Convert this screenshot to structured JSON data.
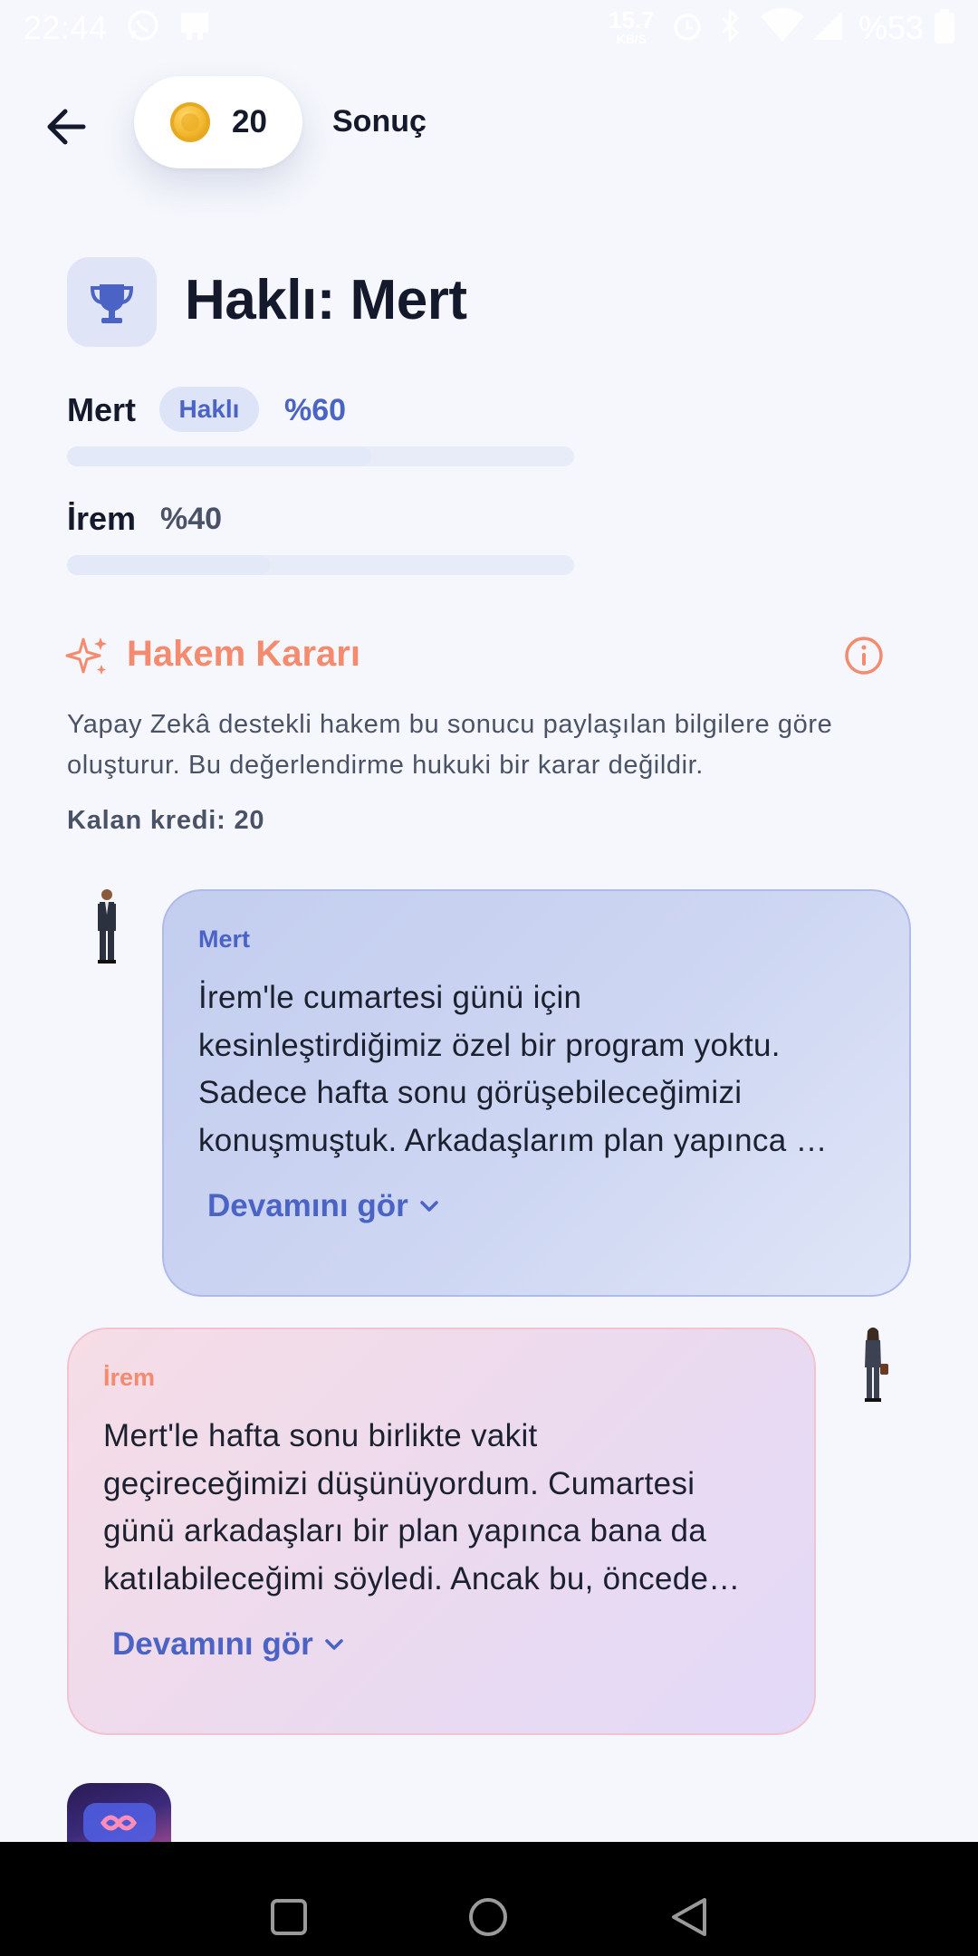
{
  "status_bar": {
    "time": "22:44",
    "net_speed_value": "15.7",
    "net_speed_unit": "KB/S",
    "battery": "%53",
    "icons": [
      "whatsapp-icon",
      "notification-icon",
      "alarm-icon",
      "bluetooth-icon",
      "wifi-icon",
      "signal-icon",
      "battery-icon"
    ]
  },
  "header": {
    "back_icon": "arrow-left-icon",
    "coin_count": "20",
    "title": "Sonuç"
  },
  "verdict": {
    "icon": "trophy-icon",
    "title": "Haklı: Mert"
  },
  "scores": [
    {
      "name": "Mert",
      "badge": "Haklı",
      "percent_label": "%60",
      "value": 0.6,
      "color": "#4a63c4"
    },
    {
      "name": "İrem",
      "badge": "",
      "percent_label": "%40",
      "value": 0.4,
      "color": "#4a5266"
    }
  ],
  "judge": {
    "icon": "sparkles-icon",
    "title": "Hakem Kararı",
    "info_icon": "info-icon",
    "description": "Yapay Zekâ destekli hakem bu sonucu paylaşılan bilgilere göre oluşturur. Bu değerlendirme hukuki bir karar değildir.",
    "credits": "Kalan kredi: 20"
  },
  "statements": [
    {
      "author": "Mert",
      "author_color": "#4a63c4",
      "lines": [
        "İrem'le cumartesi günü için",
        "kesinleştirdiğimiz özel bir program yoktu.",
        "Sadece hafta sonu görüşebileceğimizi",
        "konuşmuştuk. Arkadaşlarım plan yapınca …"
      ],
      "more_label": "Devamını gör"
    },
    {
      "author": "İrem",
      "author_color": "#f48a6e",
      "lines": [
        "Mert'le hafta sonu birlikte vakit",
        "geçireceğimizi düşünüyordum. Cumartesi",
        "günü arkadaşları bir plan yapınca bana da",
        "katılabileceğimi söyledi. Ancak bu, öncede…"
      ],
      "more_label": "Devamını gör"
    }
  ],
  "colors": {
    "background": "#f5f7fc",
    "accent_blue": "#4a63c4",
    "accent_coral": "#f48a6e",
    "text_dark": "#141a2b"
  }
}
